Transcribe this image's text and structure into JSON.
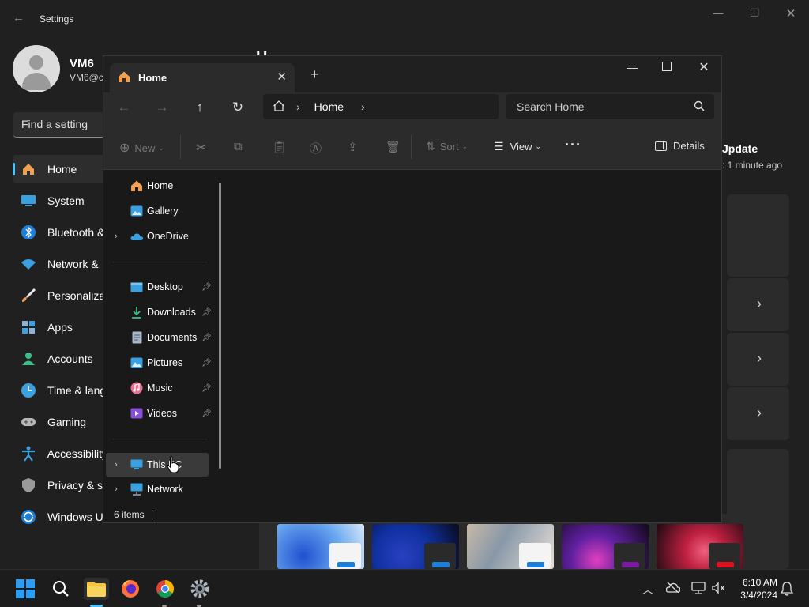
{
  "settings": {
    "title": "Settings",
    "user": {
      "name": "VM6",
      "email": "VM6@c"
    },
    "search_placeholder": "Find a setting",
    "nav": [
      {
        "label": "Home",
        "icon": "home-icon",
        "selected": true
      },
      {
        "label": "System",
        "icon": "monitor-icon"
      },
      {
        "label": "Bluetooth &",
        "icon": "bluetooth-icon"
      },
      {
        "label": "Network &",
        "icon": "wifi-icon"
      },
      {
        "label": "Personaliza",
        "icon": "brush-icon"
      },
      {
        "label": "Apps",
        "icon": "apps-icon"
      },
      {
        "label": "Accounts",
        "icon": "person-icon"
      },
      {
        "label": "Time & lang",
        "icon": "clock-icon"
      },
      {
        "label": "Gaming",
        "icon": "gamepad-icon"
      },
      {
        "label": "Accessibility",
        "icon": "accessibility-icon"
      },
      {
        "label": "Privacy & s",
        "icon": "shield-icon"
      },
      {
        "label": "Windows U",
        "icon": "update-icon"
      }
    ],
    "update": {
      "title": "Jpdate",
      "time": ": 1 minute ago"
    }
  },
  "explorer": {
    "tab_title": "Home",
    "breadcrumb": "Home",
    "search_placeholder": "Search Home",
    "toolbar": {
      "new": "New",
      "sort": "Sort",
      "view": "View",
      "details": "Details"
    },
    "nav": [
      {
        "label": "Home",
        "icon": "home-icon"
      },
      {
        "label": "Gallery",
        "icon": "gallery-icon"
      },
      {
        "label": "OneDrive",
        "icon": "onedrive-icon",
        "expandable": true
      },
      {
        "label": "Desktop",
        "icon": "desktop-icon",
        "pinned": true
      },
      {
        "label": "Downloads",
        "icon": "download-icon",
        "pinned": true
      },
      {
        "label": "Documents",
        "icon": "documents-icon",
        "pinned": true
      },
      {
        "label": "Pictures",
        "icon": "pictures-icon",
        "pinned": true
      },
      {
        "label": "Music",
        "icon": "music-icon",
        "pinned": true
      },
      {
        "label": "Videos",
        "icon": "videos-icon",
        "pinned": true
      },
      {
        "label": "This PC",
        "icon": "this-pc-icon",
        "expandable": true,
        "selected": true
      },
      {
        "label": "Network",
        "icon": "network-icon",
        "expandable": true
      }
    ],
    "status": "6 items"
  },
  "taskbar": {
    "apps": [
      "start",
      "search",
      "file-explorer",
      "firefox",
      "chrome",
      "settings"
    ],
    "time": "6:10 AM",
    "date": "3/4/2024"
  },
  "colors": {
    "accent": "#4cc2ff",
    "folder": "#f3c443"
  }
}
